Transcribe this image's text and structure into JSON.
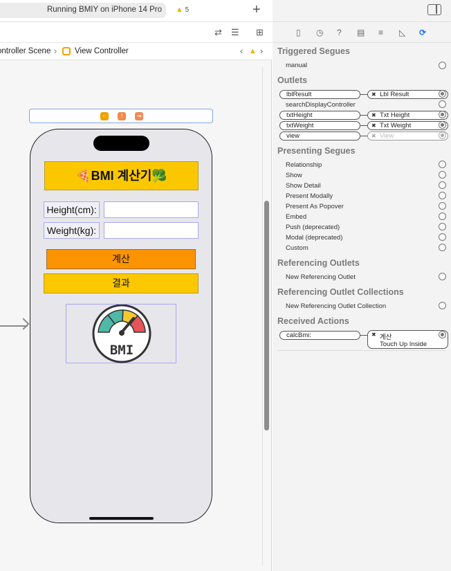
{
  "toolbar": {
    "run_status": "Running BMIY on iPhone 14 Pro",
    "warning_count": "5",
    "add_label": "+"
  },
  "jump_bar": {
    "scene": "ontroller Scene",
    "view_controller": "View Controller"
  },
  "storyboard": {
    "title_label": "🍕BMI 계산기🥦",
    "height_label": "Height(cm):",
    "weight_label": "Weight(kg):",
    "height_value": "",
    "weight_value": "",
    "calc_button": "계산",
    "result_label": "결과",
    "image_text": "BMI"
  },
  "inspector": {
    "triggered_segues": {
      "title": "Triggered Segues",
      "items": [
        "manual"
      ]
    },
    "outlets": {
      "title": "Outlets",
      "items": [
        {
          "name": "lblResult",
          "target": "Lbl Result"
        },
        {
          "name": "searchDisplayController",
          "target": ""
        },
        {
          "name": "txtHeight",
          "target": "Txt Height"
        },
        {
          "name": "txtWeight",
          "target": "Txt Weight"
        },
        {
          "name": "view",
          "target": "View"
        }
      ]
    },
    "presenting_segues": {
      "title": "Presenting Segues",
      "items": [
        "Relationship",
        "Show",
        "Show Detail",
        "Present Modally",
        "Present As Popover",
        "Embed",
        "Push (deprecated)",
        "Modal (deprecated)",
        "Custom"
      ]
    },
    "referencing_outlets": {
      "title": "Referencing Outlets",
      "item": "New Referencing Outlet"
    },
    "referencing_outlet_collections": {
      "title": "Referencing Outlet Collections",
      "item": "New Referencing Outlet Collection"
    },
    "received_actions": {
      "title": "Received Actions",
      "action": "calcBmi:",
      "target": "계산",
      "event": "Touch Up Inside"
    }
  }
}
